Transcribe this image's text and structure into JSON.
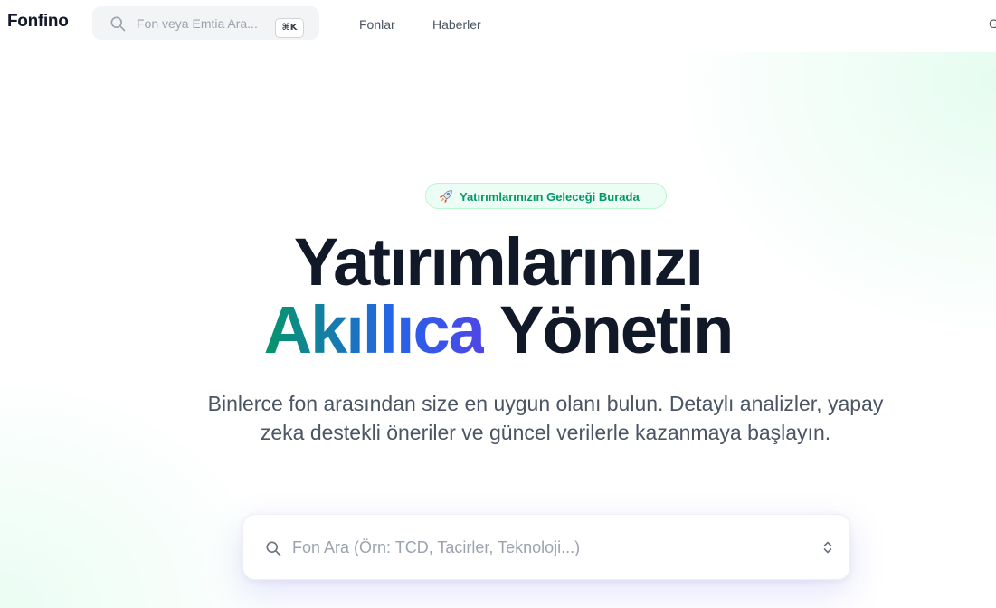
{
  "header": {
    "logo": "Fonfino",
    "search": {
      "placeholder": "Fon veya Emtia Ara...",
      "shortcut": "⌘K"
    },
    "nav": [
      {
        "label": "Fonlar"
      },
      {
        "label": "Haberler"
      }
    ],
    "cut_off_nav_label": "G"
  },
  "hero": {
    "badge": "Yatırımlarınızın Geleceği Burada",
    "title_line1": "Yatırımlarınızı",
    "title_highlight": "Akıllıca",
    "title_line2_rest": "Yönetin",
    "subtitle": "Binlerce fon arasından size en uygun olanı bulun. Detaylı analizler, yapay zeka destekli öneriler ve güncel verilerle kazanmaya başlayın.",
    "search_placeholder": "Fon Ara (Örn: TCD, Tacirler, Teknoloji...)"
  },
  "icons": {
    "search": "search-icon",
    "badge": "rocket-icon",
    "select": "chevron-up-down-icon"
  },
  "colors": {
    "accent_green": "#059669",
    "accent_blue": "#2563eb",
    "accent_indigo": "#4f46e5",
    "text_dark": "#111827",
    "text_muted": "#4b5563",
    "badge_bg": "#ecfdf5"
  }
}
